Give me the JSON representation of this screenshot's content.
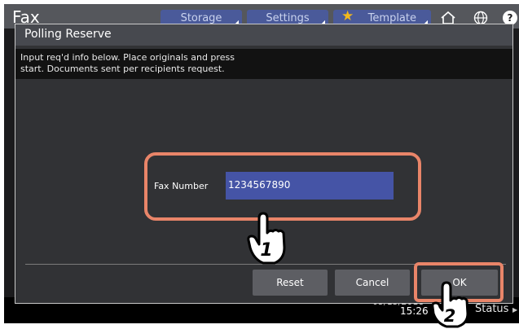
{
  "app": {
    "title": "Fax",
    "tabs": [
      {
        "label": "Storage"
      },
      {
        "label": "Settings"
      },
      {
        "label": "Template"
      }
    ]
  },
  "dialog": {
    "title": "Polling Reserve",
    "message_line1": "Input req'd info below. Place originals and press",
    "message_line2": "start. Documents sent per recipients request.",
    "fax_number_label": "Fax Number",
    "fax_number_value": "1234567890",
    "buttons": {
      "reset": "Reset",
      "cancel": "Cancel",
      "ok": "OK"
    }
  },
  "statusbar": {
    "date": "05/15/2018",
    "time": "15:26",
    "status_label": "Status"
  },
  "callouts": {
    "step1": "1",
    "step2": "2"
  },
  "icons": [
    "star-icon",
    "home-icon",
    "globe-icon",
    "help-icon",
    "pointing-hand-icon"
  ],
  "colors": {
    "accent_input": "#4554a6",
    "callout": "#e98569",
    "tab": "#4a5a9a",
    "star": "#f2b81c"
  }
}
